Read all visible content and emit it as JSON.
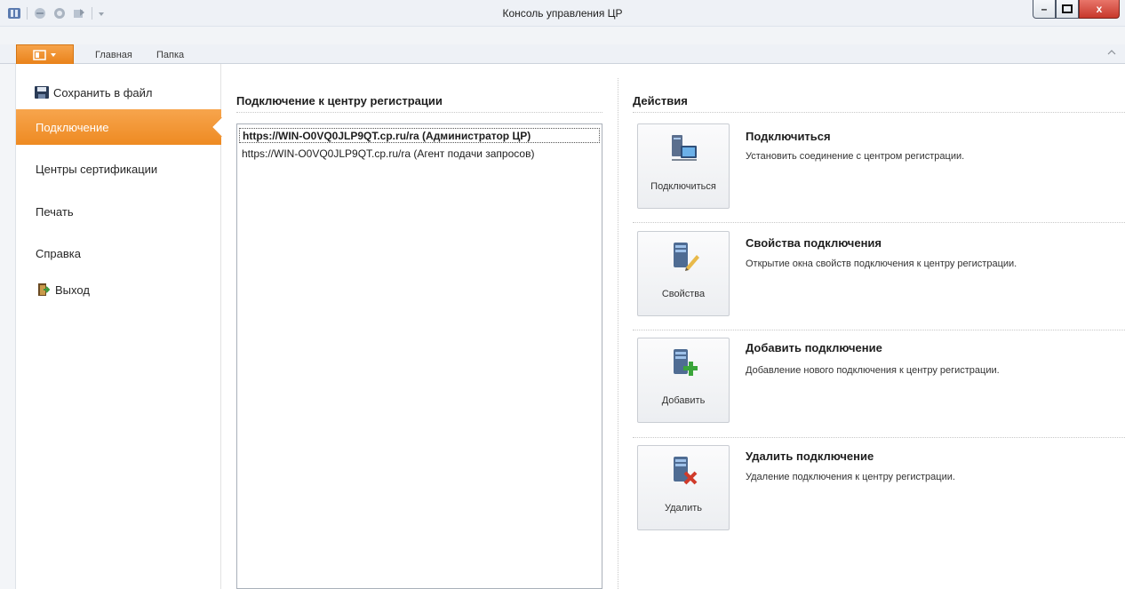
{
  "window": {
    "title": "Консоль управления ЦР",
    "min_label": "–",
    "max_label": "□",
    "close_label": "x"
  },
  "ribbon": {
    "tabs": [
      "Главная",
      "Папка"
    ]
  },
  "nav": {
    "save": "Сохранить в файл",
    "connection": "Подключение",
    "cas": "Центры сертификации",
    "print": "Печать",
    "help": "Справка",
    "exit": "Выход"
  },
  "main": {
    "connections_title": "Подключение к центру регистрации",
    "connections": [
      "https://WIN-O0VQ0JLP9QT.cp.ru/ra (Администратор ЦР)",
      "https://WIN-O0VQ0JLP9QT.cp.ru/ra (Агент подачи запросов)"
    ]
  },
  "actions": {
    "title": "Действия",
    "items": [
      {
        "button": "Подключиться",
        "title": "Подключиться",
        "desc": "Установить соединение с центром регистрации.",
        "icon": "connect-icon"
      },
      {
        "button": "Свойства",
        "title": "Свойства подключения",
        "desc": "Открытие окна свойств подключения к центру регистрации.",
        "icon": "properties-icon"
      },
      {
        "button": "Добавить",
        "title": "Добавить подключение",
        "desc": "Добавление нового подключения к центру регистрации.",
        "icon": "add-server-icon"
      },
      {
        "button": "Удалить",
        "title": "Удалить подключение",
        "desc": "Удаление подключения к центру регистрации.",
        "icon": "delete-server-icon"
      }
    ]
  },
  "colors": {
    "accent": "#ee8a22",
    "close": "#c7382b"
  }
}
